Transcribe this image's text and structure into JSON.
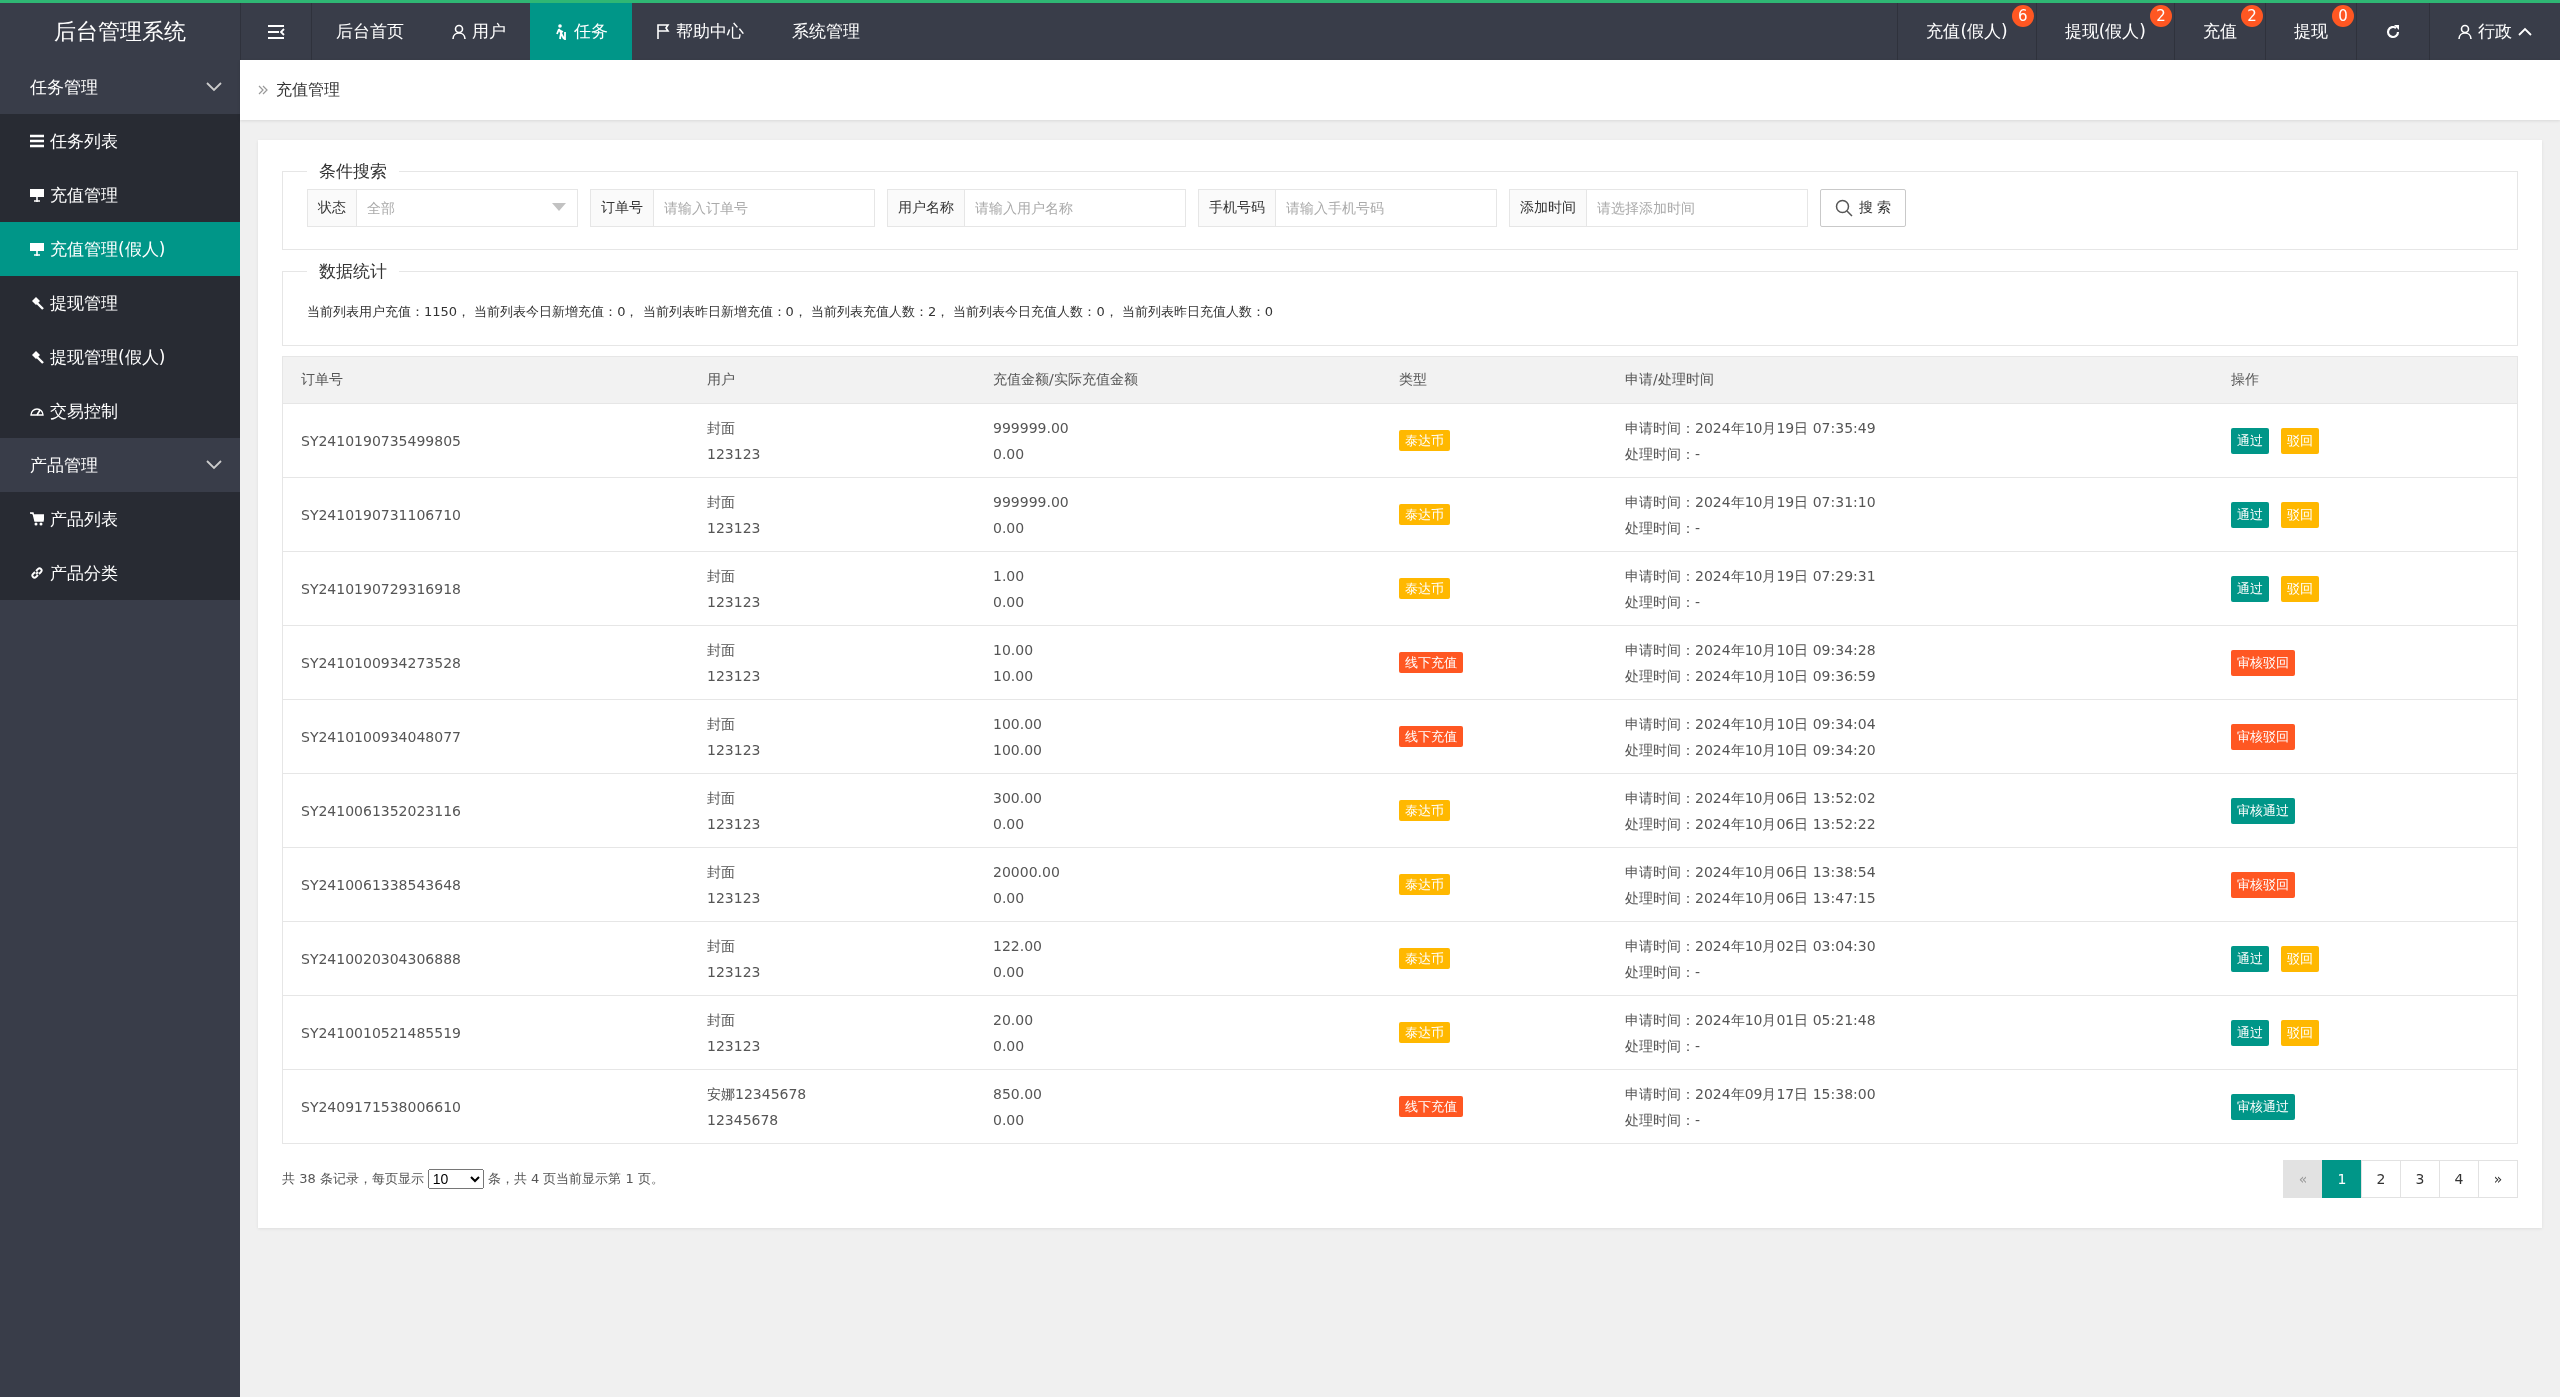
{
  "app": {
    "title": "后台管理系统"
  },
  "topnav": {
    "items": [
      {
        "label": "后台首页",
        "selected": false
      },
      {
        "label": "用户",
        "selected": false
      },
      {
        "label": "任务",
        "selected": true
      },
      {
        "label": "帮助中心",
        "selected": false
      },
      {
        "label": "系统管理",
        "selected": false
      }
    ],
    "right": [
      {
        "label": "充值(假人)",
        "badge": "6"
      },
      {
        "label": "提现(假人)",
        "badge": "2"
      },
      {
        "label": "充值",
        "badge": "2"
      },
      {
        "label": "提现",
        "badge": "0"
      }
    ],
    "user": "行政"
  },
  "sidebar": {
    "groups": [
      {
        "label": "任务管理",
        "expanded": true,
        "children": [
          {
            "label": "任务列表",
            "selected": false
          },
          {
            "label": "充值管理",
            "selected": false
          },
          {
            "label": "充值管理(假人)",
            "selected": true
          },
          {
            "label": "提现管理",
            "selected": false
          },
          {
            "label": "提现管理(假人)",
            "selected": false
          },
          {
            "label": "交易控制",
            "selected": false
          }
        ]
      },
      {
        "label": "产品管理",
        "expanded": true,
        "children": [
          {
            "label": "产品列表",
            "selected": false
          },
          {
            "label": "产品分类",
            "selected": false
          }
        ]
      }
    ]
  },
  "breadcrumb": "充值管理",
  "search": {
    "legend": "条件搜索",
    "fields": [
      {
        "label": "状态",
        "kind": "select",
        "placeholder": "全部"
      },
      {
        "label": "订单号",
        "kind": "text",
        "placeholder": "请输入订单号"
      },
      {
        "label": "用户名称",
        "kind": "text",
        "placeholder": "请输入用户名称"
      },
      {
        "label": "手机号码",
        "kind": "text",
        "placeholder": "请输入手机号码"
      },
      {
        "label": "添加时间",
        "kind": "text",
        "placeholder": "请选择添加时间"
      }
    ],
    "button": "搜 索"
  },
  "stats": {
    "legend": "数据统计",
    "text": "当前列表用户充值：1150， 当前列表今日新增充值：0， 当前列表昨日新增充值：0， 当前列表充值人数：2， 当前列表今日充值人数：0， 当前列表昨日充值人数：0"
  },
  "table": {
    "columns": [
      "订单号",
      "用户",
      "充值金额/实际充值金额",
      "类型",
      "申请/处理时间",
      "操作"
    ],
    "rows": [
      {
        "order": "SY2410190735499805",
        "user": "封面",
        "user_id": "123123",
        "amount": "999999.00",
        "actual": "0.00",
        "type": {
          "label": "泰达币",
          "kind": "coin"
        },
        "apply": "申请时间：2024年10月19日 07:35:49",
        "process": "处理时间：-",
        "actions": [
          {
            "label": "通过",
            "kind": "pass"
          },
          {
            "label": "驳回",
            "kind": "reject"
          }
        ]
      },
      {
        "order": "SY2410190731106710",
        "user": "封面",
        "user_id": "123123",
        "amount": "999999.00",
        "actual": "0.00",
        "type": {
          "label": "泰达币",
          "kind": "coin"
        },
        "apply": "申请时间：2024年10月19日 07:31:10",
        "process": "处理时间：-",
        "actions": [
          {
            "label": "通过",
            "kind": "pass"
          },
          {
            "label": "驳回",
            "kind": "reject"
          }
        ]
      },
      {
        "order": "SY2410190729316918",
        "user": "封面",
        "user_id": "123123",
        "amount": "1.00",
        "actual": "0.00",
        "type": {
          "label": "泰达币",
          "kind": "coin"
        },
        "apply": "申请时间：2024年10月19日 07:29:31",
        "process": "处理时间：-",
        "actions": [
          {
            "label": "通过",
            "kind": "pass"
          },
          {
            "label": "驳回",
            "kind": "reject"
          }
        ]
      },
      {
        "order": "SY2410100934273528",
        "user": "封面",
        "user_id": "123123",
        "amount": "10.00",
        "actual": "10.00",
        "type": {
          "label": "线下充值",
          "kind": "offline"
        },
        "apply": "申请时间：2024年10月10日 09:34:28",
        "process": "处理时间：2024年10月10日 09:36:59",
        "actions": [
          {
            "label": "审核驳回",
            "kind": "rejected"
          }
        ]
      },
      {
        "order": "SY2410100934048077",
        "user": "封面",
        "user_id": "123123",
        "amount": "100.00",
        "actual": "100.00",
        "type": {
          "label": "线下充值",
          "kind": "offline"
        },
        "apply": "申请时间：2024年10月10日 09:34:04",
        "process": "处理时间：2024年10月10日 09:34:20",
        "actions": [
          {
            "label": "审核驳回",
            "kind": "rejected"
          }
        ]
      },
      {
        "order": "SY2410061352023116",
        "user": "封面",
        "user_id": "123123",
        "amount": "300.00",
        "actual": "0.00",
        "type": {
          "label": "泰达币",
          "kind": "coin"
        },
        "apply": "申请时间：2024年10月06日 13:52:02",
        "process": "处理时间：2024年10月06日 13:52:22",
        "actions": [
          {
            "label": "审核通过",
            "kind": "approved"
          }
        ]
      },
      {
        "order": "SY2410061338543648",
        "user": "封面",
        "user_id": "123123",
        "amount": "20000.00",
        "actual": "0.00",
        "type": {
          "label": "泰达币",
          "kind": "coin"
        },
        "apply": "申请时间：2024年10月06日 13:38:54",
        "process": "处理时间：2024年10月06日 13:47:15",
        "actions": [
          {
            "label": "审核驳回",
            "kind": "rejected"
          }
        ]
      },
      {
        "order": "SY2410020304306888",
        "user": "封面",
        "user_id": "123123",
        "amount": "122.00",
        "actual": "0.00",
        "type": {
          "label": "泰达币",
          "kind": "coin"
        },
        "apply": "申请时间：2024年10月02日 03:04:30",
        "process": "处理时间：-",
        "actions": [
          {
            "label": "通过",
            "kind": "pass"
          },
          {
            "label": "驳回",
            "kind": "reject"
          }
        ]
      },
      {
        "order": "SY2410010521485519",
        "user": "封面",
        "user_id": "123123",
        "amount": "20.00",
        "actual": "0.00",
        "type": {
          "label": "泰达币",
          "kind": "coin"
        },
        "apply": "申请时间：2024年10月01日 05:21:48",
        "process": "处理时间：-",
        "actions": [
          {
            "label": "通过",
            "kind": "pass"
          },
          {
            "label": "驳回",
            "kind": "reject"
          }
        ]
      },
      {
        "order": "SY2409171538006610",
        "user": "安娜12345678",
        "user_id": "12345678",
        "amount": "850.00",
        "actual": "0.00",
        "type": {
          "label": "线下充值",
          "kind": "offline"
        },
        "apply": "申请时间：2024年09月17日 15:38:00",
        "process": "处理时间：-",
        "actions": [
          {
            "label": "审核通过",
            "kind": "approved"
          }
        ]
      }
    ]
  },
  "pager": {
    "summary_before": "共 38 条记录，每页显示",
    "page_size": "10",
    "summary_after": "条，共 4 页当前显示第 1 页。",
    "prev": "«",
    "next": "»",
    "pages": [
      {
        "label": "1",
        "selected": true
      },
      {
        "label": "2",
        "selected": false
      },
      {
        "label": "3",
        "selected": false
      },
      {
        "label": "4",
        "selected": false
      }
    ]
  }
}
